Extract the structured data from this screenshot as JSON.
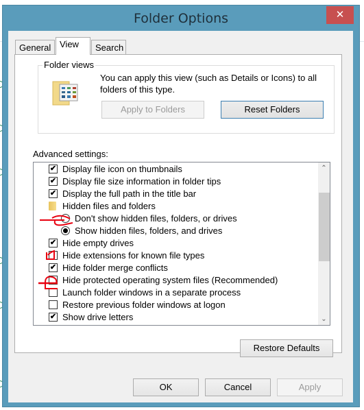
{
  "window": {
    "title": "Folder Options",
    "close_icon": "✕",
    "frame_color": "#5a9cbb",
    "close_color": "#c75050"
  },
  "tabs": [
    {
      "label": "General",
      "active": false
    },
    {
      "label": "View",
      "active": true
    },
    {
      "label": "Search",
      "active": false
    }
  ],
  "folder_views": {
    "group_label": "Folder views",
    "description": "You can apply this view (such as Details or Icons) to all folders of this type.",
    "apply_button": "Apply to Folders",
    "reset_button": "Reset Folders"
  },
  "advanced": {
    "label": "Advanced settings:",
    "items": [
      {
        "type": "checkbox",
        "checked": true,
        "label": "Display file icon on thumbnails"
      },
      {
        "type": "checkbox",
        "checked": true,
        "label": "Display file size information in folder tips"
      },
      {
        "type": "checkbox",
        "checked": true,
        "label": "Display the full path in the title bar"
      },
      {
        "type": "folder",
        "label": "Hidden files and folders"
      },
      {
        "type": "radio",
        "checked": false,
        "label": "Don't show hidden files, folders, or drives"
      },
      {
        "type": "radio",
        "checked": true,
        "label": "Show hidden files, folders, and drives"
      },
      {
        "type": "checkbox",
        "checked": true,
        "label": "Hide empty drives"
      },
      {
        "type": "checkbox",
        "checked": false,
        "label": "Hide extensions for known file types"
      },
      {
        "type": "checkbox",
        "checked": true,
        "label": "Hide folder merge conflicts"
      },
      {
        "type": "checkbox",
        "checked": false,
        "label": "Hide protected operating system files (Recommended)"
      },
      {
        "type": "checkbox",
        "checked": false,
        "label": "Launch folder windows in a separate process"
      },
      {
        "type": "checkbox",
        "checked": false,
        "label": "Restore previous folder windows at logon"
      },
      {
        "type": "checkbox",
        "checked": true,
        "label": "Show drive letters"
      }
    ],
    "scroll_up_icon": "⌃",
    "scroll_down_icon": "⌄",
    "check_glyph": "✔"
  },
  "buttons": {
    "restore_defaults": "Restore Defaults",
    "ok": "OK",
    "cancel": "Cancel",
    "apply": "Apply"
  },
  "annotations": {
    "color": "#e8000f"
  }
}
